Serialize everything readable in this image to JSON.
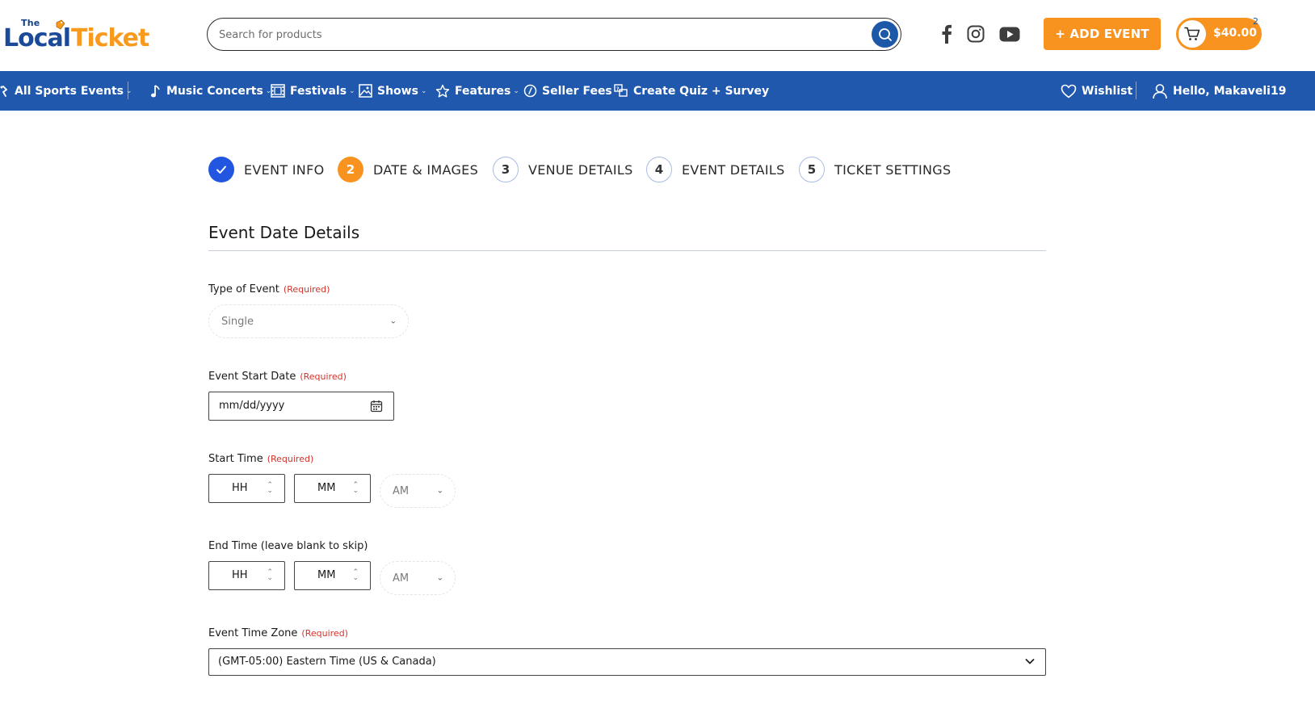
{
  "header": {
    "logo": {
      "the": "The",
      "local": "Local",
      "ticket": "Ticket"
    },
    "search": {
      "placeholder": "Search for products"
    },
    "add_event_label": "+ ADD EVENT",
    "cart": {
      "amount": "$40.00",
      "count": "2"
    },
    "social": [
      "facebook-icon",
      "instagram-icon",
      "youtube-icon"
    ]
  },
  "nav": {
    "items": [
      {
        "label": "All Sports Events",
        "chev": "⌄"
      },
      {
        "label": "Music Concerts",
        "chev": "⌄"
      },
      {
        "label": "Festivals",
        "chev": "⌄"
      },
      {
        "label": "Shows",
        "chev": "⌄"
      },
      {
        "label": "Features",
        "chev": "⌄"
      },
      {
        "label": "Seller Fees"
      },
      {
        "label": "Create Quiz + Survey"
      }
    ],
    "wishlist": "Wishlist",
    "user": "Hello, Makaveli19"
  },
  "stepper": {
    "steps": [
      {
        "num": "",
        "label": "EVENT INFO",
        "state": "done"
      },
      {
        "num": "2",
        "label": "DATE & IMAGES",
        "state": "active"
      },
      {
        "num": "3",
        "label": "VENUE DETAILS",
        "state": "todo"
      },
      {
        "num": "4",
        "label": "EVENT DETAILS",
        "state": "todo"
      },
      {
        "num": "5",
        "label": "TICKET SETTINGS",
        "state": "todo"
      }
    ]
  },
  "form": {
    "section_title": "Event Date Details",
    "required_text": "(Required)",
    "type_of_event": {
      "label": "Type of Event",
      "value": "Single"
    },
    "start_date": {
      "label": "Event Start Date",
      "placeholder": "mm/dd/yyyy"
    },
    "start_time": {
      "label": "Start Time",
      "hh": "HH",
      "mm": "MM",
      "ampm": "AM"
    },
    "end_time": {
      "label": "End Time (leave blank to skip)",
      "hh": "HH",
      "mm": "MM",
      "ampm": "AM"
    },
    "time_zone": {
      "label": "Event Time Zone",
      "value": "(GMT-05:00) Eastern Time (US & Canada)"
    }
  },
  "colors": {
    "brand_blue": "#1f58ad",
    "brand_orange": "#f7931e",
    "step_done": "#2255e0",
    "required_red": "#d2332b"
  }
}
